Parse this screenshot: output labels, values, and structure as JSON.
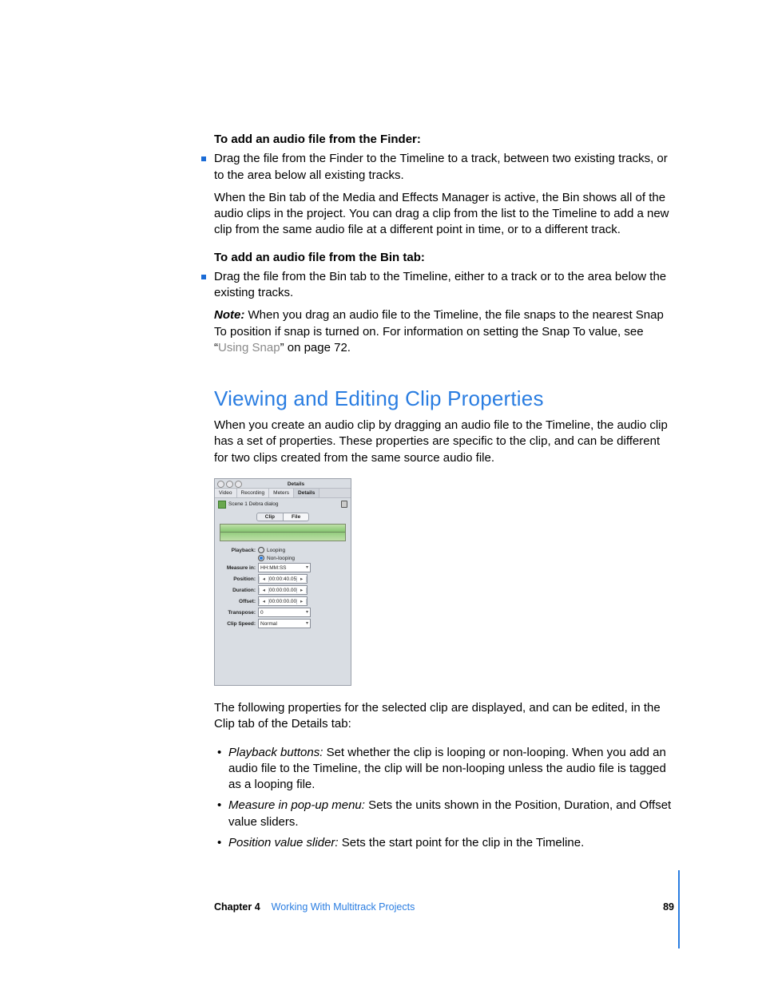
{
  "section1": {
    "lead": "To add an audio file from the Finder:",
    "bullet": "Drag the file from the Finder to the Timeline to a track, between two existing tracks, or to the area below all existing tracks.",
    "para": "When the Bin tab of the Media and Effects Manager is active, the Bin shows all of the audio clips in the project. You can drag a clip from the list to the Timeline to add a new clip from the same audio file at a different point in time, or to a different track."
  },
  "section2": {
    "lead": "To add an audio file from the Bin tab:",
    "bullet": "Drag the file from the Bin tab to the Timeline, either to a track or to the area below the existing tracks.",
    "note_label": "Note:",
    "note_body_a": "  When you drag an audio file to the Timeline, the file snaps to the nearest Snap To position if snap is turned on. For information on setting the Snap To value, see “",
    "note_xref": "Using Snap",
    "note_body_b": "” on page 72."
  },
  "heading": "Viewing and Editing Clip Properties",
  "intro": "When you create an audio clip by dragging an audio file to the Timeline, the audio clip has a set of properties. These properties are specific to the clip, and can be different for two clips created from the same source audio file.",
  "figure": {
    "window_title": "Details",
    "tabs": [
      "Video",
      "Recording",
      "Meters",
      "Details"
    ],
    "clip_name": "Scene 1 Debra dialog",
    "subtabs": [
      "Clip",
      "File"
    ],
    "rows": {
      "playback_label": "Playback:",
      "looping": "Looping",
      "nonlooping": "Non-looping",
      "measure_label": "Measure in:",
      "measure_value": "HH:MM:SS",
      "position_label": "Position:",
      "position_value": "00:00:40.05",
      "duration_label": "Duration:",
      "duration_value": "00:00:00.00",
      "offset_label": "Offset:",
      "offset_value": "00:00:00.00",
      "transpose_label": "Transpose:",
      "transpose_value": "0",
      "clipspeed_label": "Clip Speed:",
      "clipspeed_value": "Normal"
    }
  },
  "after_fig": "The following properties for the selected clip are displayed, and can be edited, in the Clip tab of the Details tab:",
  "props": [
    {
      "term": "Playback buttons:",
      "body": "  Set whether the clip is looping or non-looping. When you add an audio file to the Timeline, the clip will be non-looping unless the audio file is tagged as a looping file."
    },
    {
      "term": "Measure in pop-up menu:",
      "body": "  Sets the units shown in the Position, Duration, and Offset value sliders."
    },
    {
      "term": "Position value slider:",
      "body": "  Sets the start point for the clip in the Timeline."
    }
  ],
  "footer": {
    "chapter": "Chapter 4",
    "name": "Working With Multitrack Projects",
    "page": "89"
  }
}
